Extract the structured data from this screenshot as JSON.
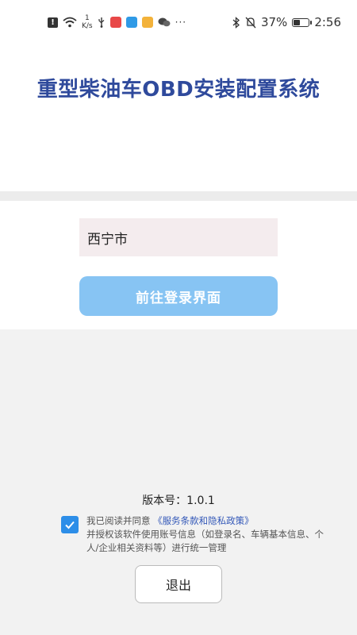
{
  "status_bar": {
    "speed_value": "1",
    "speed_unit": "K/s",
    "battery_percent": "37%",
    "battery_level": 0.37,
    "time": "2:56",
    "more_indicator": "···",
    "alert_glyph": "!"
  },
  "header": {
    "title": "重型柴油车OBD安装配置系统"
  },
  "form": {
    "city_value": "西宁市",
    "login_button_label": "前往登录界面"
  },
  "footer": {
    "version_label": "版本号：1.0.1",
    "agreement_prefix": "我已阅读并同意",
    "policy_link": "《服务条款和隐私政策》",
    "agreement_body": "并授权该软件使用账号信息（如登录名、车辆基本信息、个人/企业相关资料等）进行统一管理",
    "checkbox_checked": true,
    "exit_button_label": "退出"
  },
  "colors": {
    "title": "#2f4a9c",
    "login_button": "#87c4f3",
    "checkbox": "#2d8ee8",
    "policy_link": "#3358b8"
  }
}
